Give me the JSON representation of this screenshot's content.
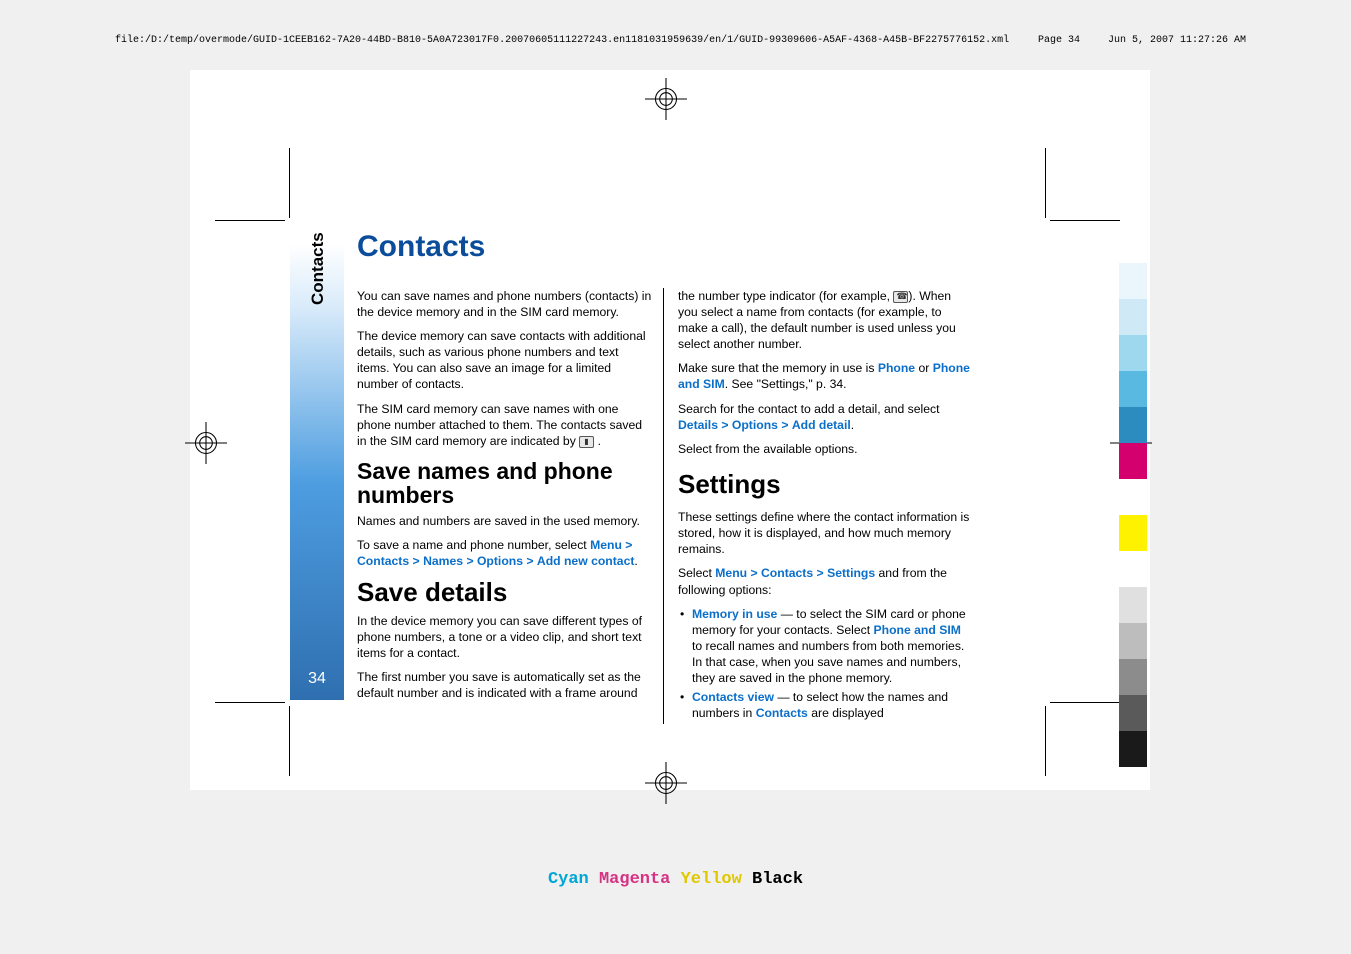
{
  "header": {
    "file_path": "file:/D:/temp/overmode/GUID-1CEEB162-7A20-44BD-B810-5A0A723017F0.20070605111227243.en1181031959639/en/1/GUID-99309606-A5AF-4368-A45B-BF2275776152.xml",
    "page_label": "Page 34",
    "timestamp": "Jun 5, 2007 11:27:26 AM"
  },
  "sidebar": {
    "section_label": "Contacts",
    "page_number": "34"
  },
  "title": "Contacts",
  "left": {
    "p1": "You can save names and phone numbers (contacts) in the device memory and in the SIM card memory.",
    "p2": "The device memory can save contacts with additional details, such as various phone numbers and text items. You can also save an image for a limited number of contacts.",
    "p3a": "The SIM card memory can save names with one phone number attached to them. The contacts saved in the SIM card memory are indicated by ",
    "p3b": " .",
    "h_save_names": "Save names and phone numbers",
    "p4": "Names and numbers are saved in the used memory.",
    "p5a": "To save a name and phone number, select ",
    "menu": "Menu",
    "contacts": "Contacts",
    "names": "Names",
    "options": "Options",
    "add_new_contact": "Add new contact",
    "h_save_details": "Save details",
    "p6": "In the device memory you can save different types of phone numbers, a tone or a video clip, and short text items for a contact.",
    "p7": "The first number you save is automatically set as the default number and is indicated with a frame around"
  },
  "right": {
    "p1a": "the number type indicator (for example, ",
    "p1b": "). When you select a name from contacts (for example, to make a call), the default number is used unless you select another number.",
    "p2a": "Make sure that the memory in use is ",
    "phone": "Phone",
    "or_txt": " or ",
    "phone_and_sim": "Phone and SIM",
    "p2b": ". See \"Settings,\" p. 34.",
    "p3a": "Search for the contact to add a detail, and select ",
    "details": "Details",
    "options": "Options",
    "add_detail": "Add detail",
    "p4": "Select from the available options.",
    "h_settings": "Settings",
    "p5": "These settings define where the contact information is stored, how it is displayed, and how much memory remains.",
    "p6a": "Select ",
    "menu": "Menu",
    "contacts": "Contacts",
    "settings": "Settings",
    "p6b": " and from the following options:",
    "li1_lead": "Memory in use",
    "li1_txt1": "  — to select the SIM card or phone memory for your contacts. Select ",
    "li1_pas": "Phone and SIM",
    "li1_txt2": " to recall names and numbers from both memories. In that case, when you save names and numbers, they are saved in the phone memory.",
    "li2_lead": "Contacts view",
    "li2_txt1": "  — to select how the names and numbers in ",
    "li2_contacts": "Contacts",
    "li2_txt2": " are displayed"
  },
  "cmyk": {
    "c": "Cyan",
    "m": "Magenta",
    "y": "Yellow",
    "k": "Black"
  },
  "tabs": [
    {
      "name": "tab-light-1",
      "color": "#eaf6fb"
    },
    {
      "name": "tab-light-2",
      "color": "#cfeaf6"
    },
    {
      "name": "tab-blue-1",
      "color": "#9ed8ef"
    },
    {
      "name": "tab-blue-2",
      "color": "#5ab9e0"
    },
    {
      "name": "tab-blue-3",
      "color": "#2c8bbf"
    },
    {
      "name": "tab-magenta",
      "color": "#d4006e"
    },
    {
      "name": "tab-gap-1",
      "color": "#ffffff"
    },
    {
      "name": "tab-yellow",
      "color": "#fff200"
    },
    {
      "name": "tab-gap-2",
      "color": "#ffffff"
    },
    {
      "name": "tab-grey-1",
      "color": "#e0e0e0"
    },
    {
      "name": "tab-grey-2",
      "color": "#bdbdbd"
    },
    {
      "name": "tab-grey-3",
      "color": "#8c8c8c"
    },
    {
      "name": "tab-grey-4",
      "color": "#5a5a5a"
    },
    {
      "name": "tab-black",
      "color": "#1a1a1a"
    }
  ]
}
